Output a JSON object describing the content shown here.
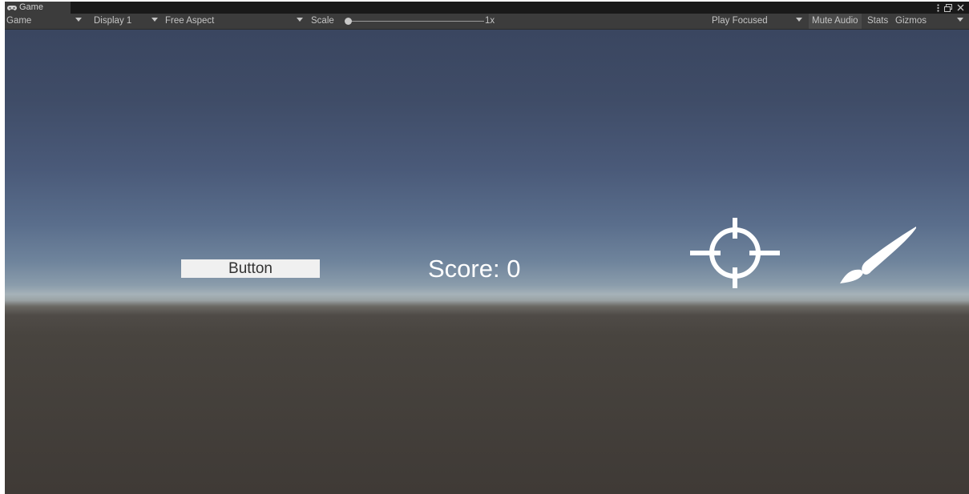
{
  "window": {
    "tab_label": "Game",
    "tab_icon": "gamepad-icon",
    "menu_icon": "more-options-icon",
    "maximize_icon": "maximize-icon",
    "close_icon": "close-icon"
  },
  "toolbar": {
    "view_mode": "Game",
    "display": "Display 1",
    "aspect": "Free Aspect",
    "scale_label": "Scale",
    "scale_value": "1x",
    "scale_level": 0,
    "play_mode": "Play Focused",
    "mute_audio": "Mute Audio",
    "stats": "Stats",
    "gizmos": "Gizmos"
  },
  "game": {
    "button_label": "Button",
    "score_text": "Score: 0",
    "crosshair_icon": "crosshair-icon",
    "brush_icon": "paintbrush-icon"
  },
  "colors": {
    "editor_bg": "#3c3c3c",
    "sky_top": "#3a4660",
    "horizon": "#a6b2b8",
    "ground": "#3f3a36",
    "ui_white": "#ffffff"
  }
}
